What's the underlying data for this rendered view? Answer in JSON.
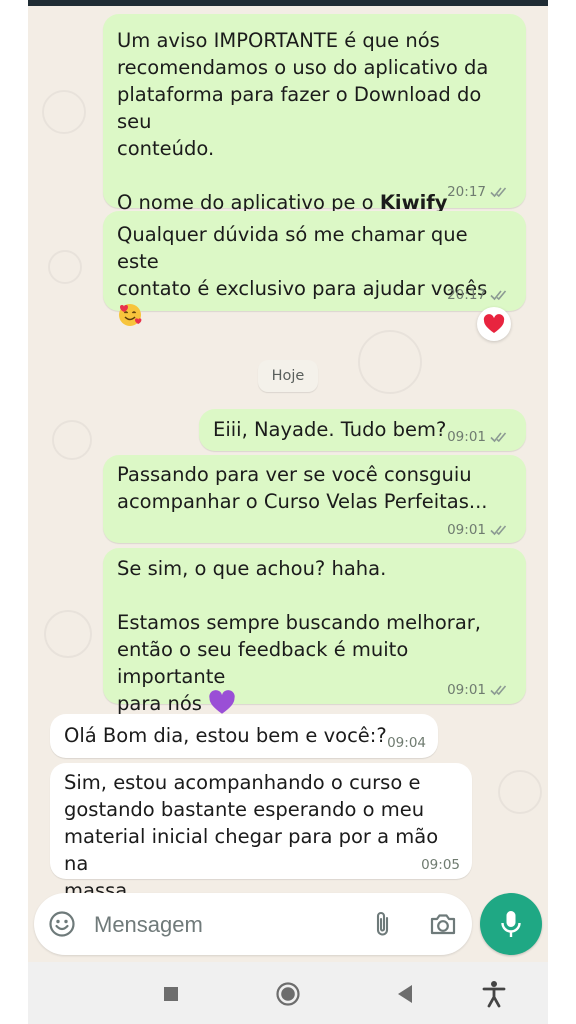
{
  "messages": [
    {
      "id": "m1",
      "dir": "out",
      "text": "Um aviso IMPORTANTE é que nós\nrecomendamos o uso do aplicativo da\nplataforma para fazer o Download do seu\nconteúdo.\n\nO nome do aplicativo pe o ",
      "bold": "Kiwify Mobile",
      "suffix": ".",
      "time": "20:17",
      "ticks": "read"
    },
    {
      "id": "m2",
      "dir": "out",
      "text": "Qualquer dúvida só me chamar que este\ncontato é exclusivo para ajudar vocês ",
      "emoji": "smiling-face-with-hearts",
      "time": "20:17",
      "ticks": "read",
      "reaction": "red-heart"
    },
    {
      "id": "m3",
      "dir": "out",
      "text": "Eiii, Nayade. Tudo bem?",
      "time": "09:01",
      "ticks": "read"
    },
    {
      "id": "m4",
      "dir": "out",
      "text": "Passando para ver se você consguiu\nacompanhar o Curso Velas Perfeitas...",
      "time": "09:01",
      "ticks": "read"
    },
    {
      "id": "m5",
      "dir": "out",
      "text": "Se sim, o que achou? haha.\n\nEstamos sempre buscando melhorar,\nentão o seu feedback é muito importante\npara nós ",
      "emoji": "purple-heart",
      "time": "09:01",
      "ticks": "read"
    },
    {
      "id": "m6",
      "dir": "in",
      "text": "Olá Bom dia, estou bem e você:?",
      "time": "09:04"
    },
    {
      "id": "m7",
      "dir": "in",
      "text": "Sim, estou acompanhando o curso e\ngostando bastante esperando o meu\nmaterial inicial chegar para por a mão na\nmassa",
      "time": "09:05"
    }
  ],
  "date_separator": "Hoje",
  "composer": {
    "placeholder": "Mensagem",
    "icons": [
      "emoji-icon",
      "attach-icon",
      "camera-icon"
    ],
    "send_icon": "mic-icon"
  },
  "colors": {
    "outgoing": "#dcf8c6",
    "incoming": "#ffffff",
    "wallpaper": "#f3ede5",
    "accent": "#1fa884"
  },
  "navbar": {
    "icons": [
      "recents-icon",
      "home-icon",
      "back-icon",
      "accessibility-icon"
    ]
  }
}
